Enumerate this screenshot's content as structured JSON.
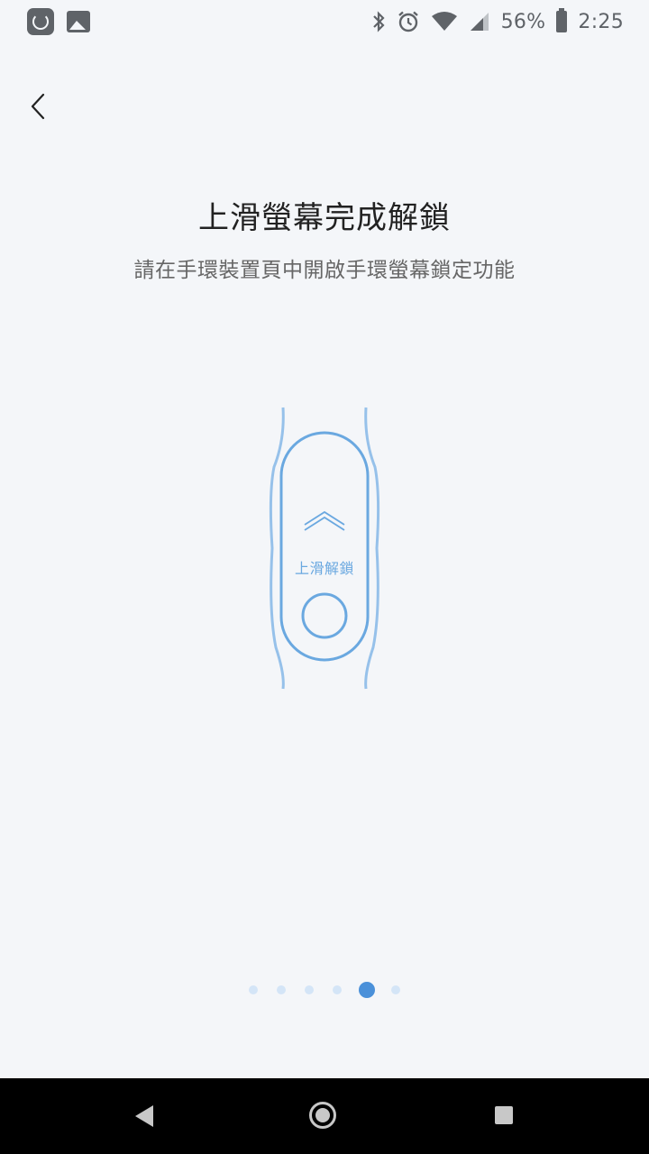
{
  "status_bar": {
    "battery_percent": "56%",
    "time": "2:25"
  },
  "header": {
    "title": "上滑螢幕完成解鎖",
    "subtitle": "請在手環裝置頁中開啟手環螢幕鎖定功能"
  },
  "illustration": {
    "band_label": "上滑解鎖",
    "accent_color": "#6aa8e0"
  },
  "pager": {
    "total_pages": 6,
    "current_page": 5,
    "active_color": "#4a90d9",
    "inactive_color": "#d4e5f7"
  }
}
